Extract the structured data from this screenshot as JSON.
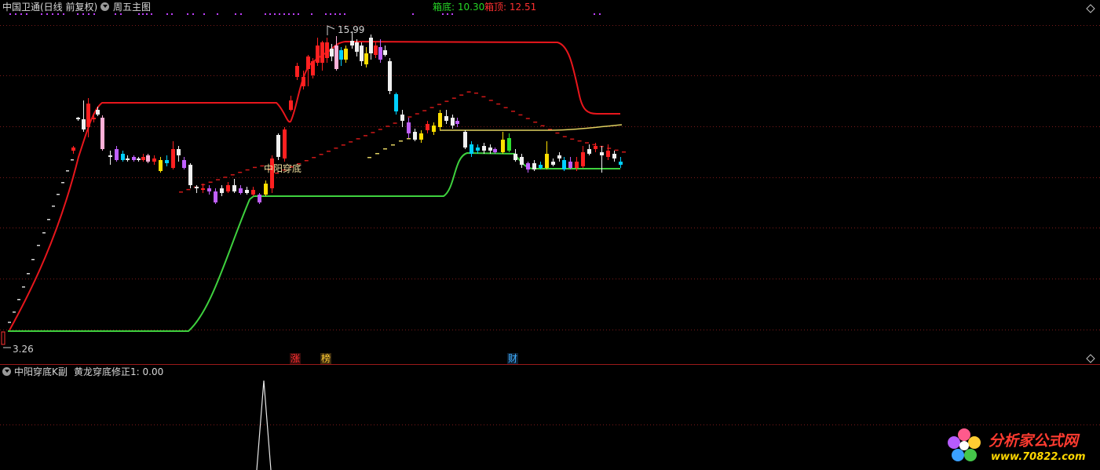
{
  "header": {
    "stock_title": "中国卫通(日线 前复权)",
    "main_indicator": "周五主图",
    "box_bottom_label": "箱底: 10.30",
    "box_top_label": "箱顶: 12.51"
  },
  "annotations": {
    "high_price": "15.99",
    "low_price": "3.26",
    "signal_label": "中阳穿底",
    "event_tags": [
      "涨",
      "榜",
      "财"
    ]
  },
  "sub_panel": {
    "title": "中阳穿底K副",
    "indicator_value": "黄龙穿底修正1: 0.00"
  },
  "watermark": {
    "brand": "分析家公式网",
    "url": "www.70822.com"
  },
  "colors": {
    "background": "#000000",
    "resistance_line": "#e8161c",
    "support_line": "#3ed13e",
    "midline": "#e0d060",
    "up_candle": "#ff2020",
    "down_candle": "#00d0ff",
    "grid": "#7a1a1a",
    "box_bottom": "#26d626",
    "box_top": "#ff3030"
  },
  "chart_data": {
    "type": "candlestick",
    "price_range": [
      3.26,
      15.99
    ],
    "box_levels": {
      "bottom": 10.3,
      "top": 12.51
    },
    "sub_indicator": {
      "name": "黄龙穿底修正1",
      "value": 0.0
    }
  }
}
